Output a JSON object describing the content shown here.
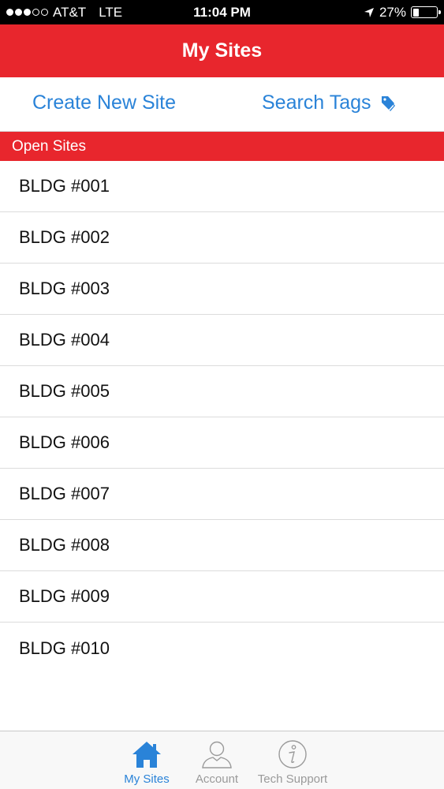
{
  "status_bar": {
    "carrier": "AT&T",
    "network": "LTE",
    "time": "11:04 PM",
    "battery": "27%",
    "battery_level": 0.27,
    "signal_strength": 3,
    "signal_max": 5
  },
  "nav": {
    "title": "My Sites"
  },
  "actions": {
    "create_label": "Create New Site",
    "search_label": "Search Tags"
  },
  "section": {
    "title": "Open Sites"
  },
  "sites": [
    {
      "label": "BLDG #001"
    },
    {
      "label": "BLDG #002"
    },
    {
      "label": "BLDG #003"
    },
    {
      "label": "BLDG #004"
    },
    {
      "label": "BLDG #005"
    },
    {
      "label": "BLDG #006"
    },
    {
      "label": "BLDG #007"
    },
    {
      "label": "BLDG #008"
    },
    {
      "label": "BLDG #009"
    },
    {
      "label": "BLDG #010"
    }
  ],
  "tabs": [
    {
      "label": "My Sites",
      "icon": "home-icon",
      "active": true
    },
    {
      "label": "Account",
      "icon": "person-icon",
      "active": false
    },
    {
      "label": "Tech Support",
      "icon": "info-icon",
      "active": false
    }
  ],
  "colors": {
    "brand_red": "#e8262d",
    "link_blue": "#2a83d8",
    "inactive_gray": "#9a9a9a"
  }
}
